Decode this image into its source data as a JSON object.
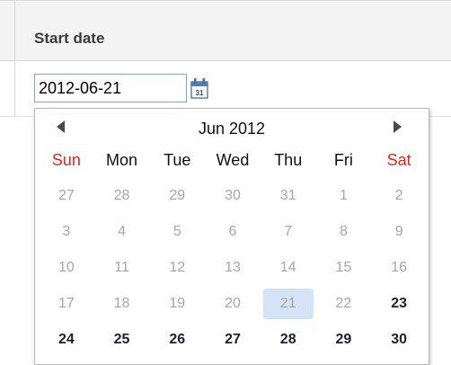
{
  "table": {
    "column_header": "Start date"
  },
  "date_field": {
    "value": "2012-06-21"
  },
  "calendar": {
    "month_title": "Jun 2012",
    "trigger_icon_text": "31",
    "weekdays": [
      "Sun",
      "Mon",
      "Tue",
      "Wed",
      "Thu",
      "Fri",
      "Sat"
    ],
    "weekend_color": "#e8231c",
    "selected_bg": "#d4e3f6",
    "days": [
      {
        "label": "27",
        "state": "disabled"
      },
      {
        "label": "28",
        "state": "disabled"
      },
      {
        "label": "29",
        "state": "disabled"
      },
      {
        "label": "30",
        "state": "disabled"
      },
      {
        "label": "31",
        "state": "disabled"
      },
      {
        "label": "1",
        "state": "disabled"
      },
      {
        "label": "2",
        "state": "disabled"
      },
      {
        "label": "3",
        "state": "disabled"
      },
      {
        "label": "4",
        "state": "disabled"
      },
      {
        "label": "5",
        "state": "disabled"
      },
      {
        "label": "6",
        "state": "disabled"
      },
      {
        "label": "7",
        "state": "disabled"
      },
      {
        "label": "8",
        "state": "disabled"
      },
      {
        "label": "9",
        "state": "disabled"
      },
      {
        "label": "10",
        "state": "disabled"
      },
      {
        "label": "11",
        "state": "disabled"
      },
      {
        "label": "12",
        "state": "disabled"
      },
      {
        "label": "13",
        "state": "disabled"
      },
      {
        "label": "14",
        "state": "disabled"
      },
      {
        "label": "15",
        "state": "disabled"
      },
      {
        "label": "16",
        "state": "disabled"
      },
      {
        "label": "17",
        "state": "disabled"
      },
      {
        "label": "18",
        "state": "disabled"
      },
      {
        "label": "19",
        "state": "disabled"
      },
      {
        "label": "20",
        "state": "disabled"
      },
      {
        "label": "21",
        "state": "selected"
      },
      {
        "label": "22",
        "state": "disabled"
      },
      {
        "label": "23",
        "state": "active"
      },
      {
        "label": "24",
        "state": "active"
      },
      {
        "label": "25",
        "state": "active"
      },
      {
        "label": "26",
        "state": "active"
      },
      {
        "label": "27",
        "state": "active"
      },
      {
        "label": "28",
        "state": "active"
      },
      {
        "label": "29",
        "state": "active"
      },
      {
        "label": "30",
        "state": "active"
      }
    ]
  },
  "icons": {
    "prev": "triangle-left-icon",
    "next": "triangle-right-icon",
    "calendar": "calendar-icon"
  }
}
